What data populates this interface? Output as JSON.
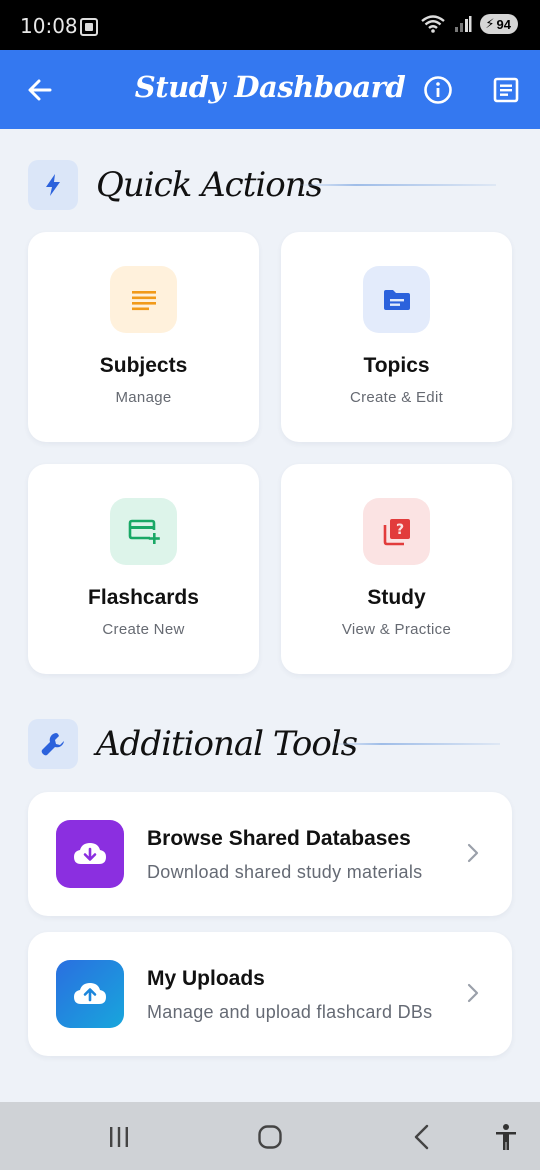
{
  "status_bar": {
    "time": "10:08",
    "battery": "94"
  },
  "app_bar": {
    "title": "Study Dashboard",
    "back_icon": "arrow-left-icon",
    "info_icon": "info-circle-icon",
    "notes_icon": "notes-icon"
  },
  "quick_actions": {
    "title": "Quick Actions",
    "icon": "lightning-icon",
    "cards": [
      {
        "title": "Subjects",
        "subtitle": "Manage",
        "icon": "list-lines-icon",
        "icon_bg": "#fff1dc",
        "icon_color": "#f19a1a"
      },
      {
        "title": "Topics",
        "subtitle": "Create & Edit",
        "icon": "folder-icon",
        "icon_bg": "#e3ebfb",
        "icon_color": "#2c62dc"
      },
      {
        "title": "Flashcards",
        "subtitle": "Create New",
        "icon": "card-add-icon",
        "icon_bg": "#ddf4ea",
        "icon_color": "#19a866"
      },
      {
        "title": "Study",
        "subtitle": "View & Practice",
        "icon": "quiz-icon",
        "icon_bg": "#fbe3e3",
        "icon_color": "#e23c3c"
      }
    ]
  },
  "additional_tools": {
    "title": "Additional Tools",
    "icon": "wrench-icon",
    "items": [
      {
        "title": "Browse Shared Databases",
        "subtitle": "Download shared study materials",
        "icon": "cloud-download-icon",
        "icon_color": "#8b2fe0"
      },
      {
        "title": "My Uploads",
        "subtitle": "Manage and upload flashcard DBs",
        "icon": "cloud-upload-icon",
        "icon_color": "#1c86dc"
      }
    ]
  },
  "colors": {
    "app_bar": "#3478f0",
    "background": "#eef2f8"
  }
}
